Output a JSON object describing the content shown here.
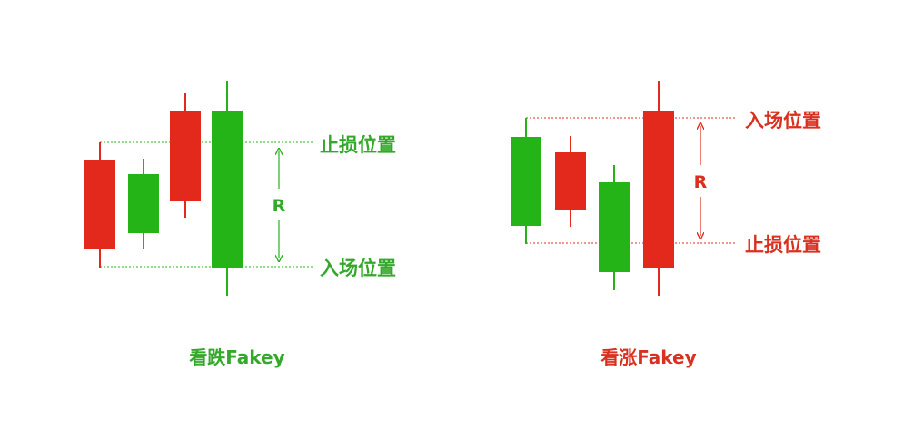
{
  "colors": {
    "red": "#e2291c",
    "green": "#24b418",
    "red_text": "#d9301f",
    "green_text": "#34a82b"
  },
  "bearish": {
    "caption": "看跌Fakey",
    "stop_label": "止损位置",
    "entry_label": "入场位置",
    "r_label": "R"
  },
  "bullish": {
    "caption": "看涨Fakey",
    "entry_label": "入场位置",
    "stop_label": "止损位置",
    "r_label": "R"
  }
}
